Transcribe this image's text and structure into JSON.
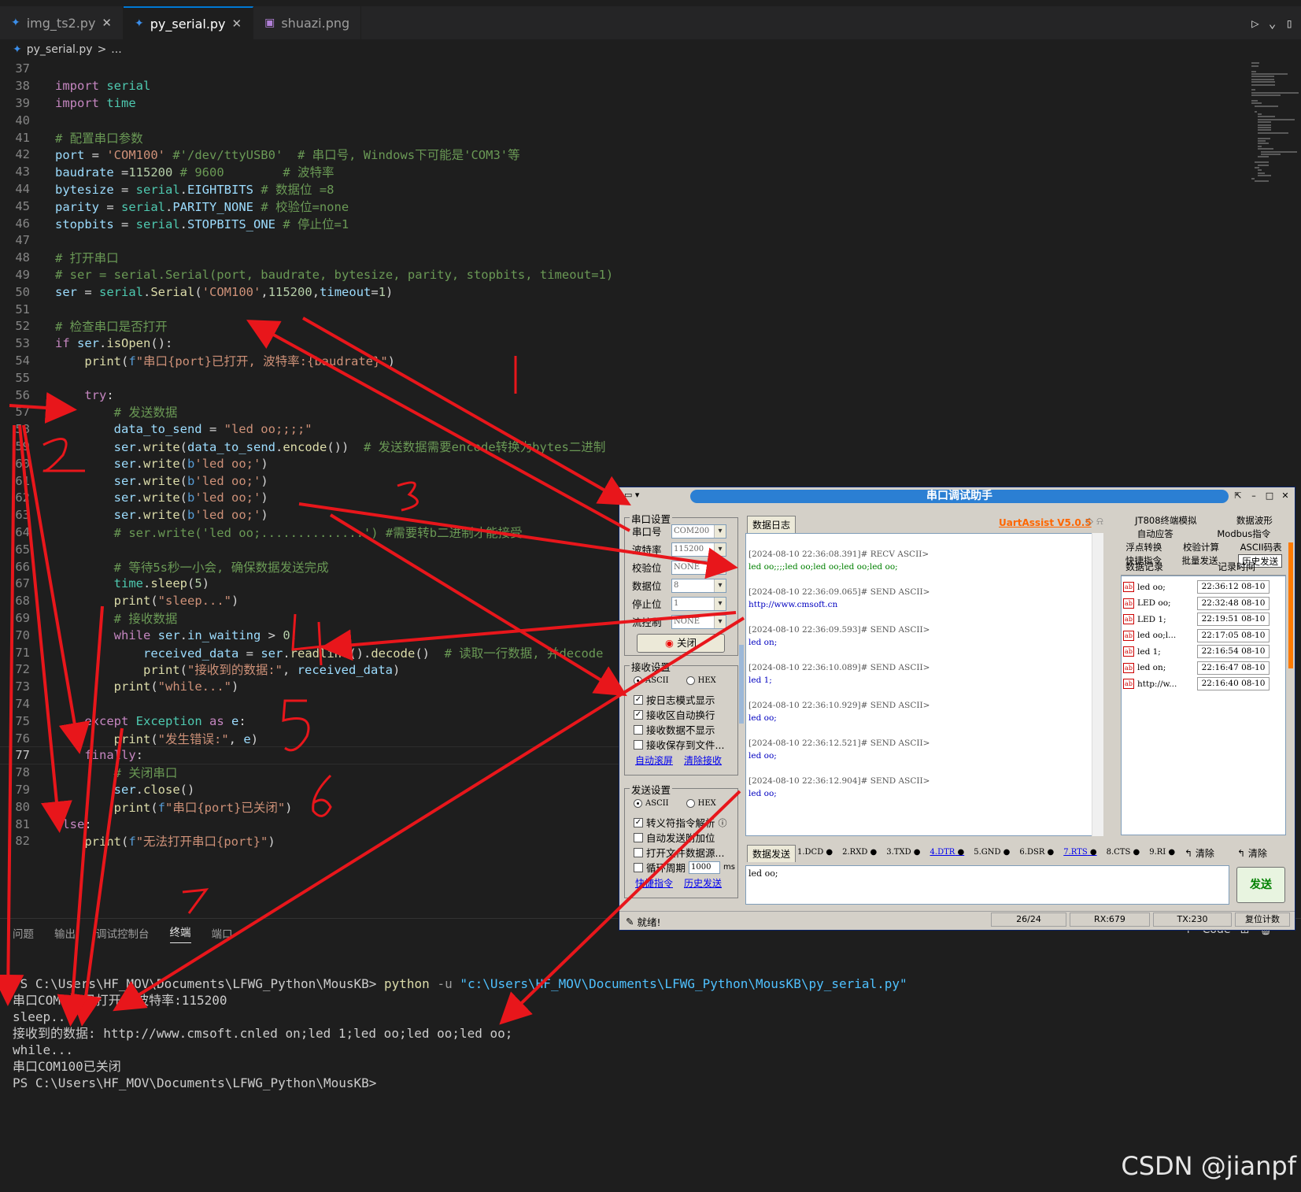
{
  "tabs": [
    {
      "label": "img_ts2.py",
      "icon": "python-file-icon"
    },
    {
      "label": "py_serial.py",
      "icon": "python-file-icon",
      "active": true
    },
    {
      "label": "shuazi.png",
      "icon": "image-file-icon"
    }
  ],
  "breadcrumb": {
    "file": "py_serial.py",
    "sep": ">",
    "more": "..."
  },
  "editor": {
    "current_line": "77",
    "lines": [
      {
        "n": "37",
        "t": ""
      },
      {
        "n": "38",
        "t": "import serial"
      },
      {
        "n": "39",
        "t": "import time"
      },
      {
        "n": "40",
        "t": ""
      },
      {
        "n": "41",
        "t": "# 配置串口参数"
      },
      {
        "n": "42",
        "t": "port = 'COM100' #'/dev/ttyUSB0'  # 串口号, Windows下可能是'COM3'等"
      },
      {
        "n": "43",
        "t": "baudrate =115200 # 9600        # 波特率"
      },
      {
        "n": "44",
        "t": "bytesize = serial.EIGHTBITS # 数据位 =8"
      },
      {
        "n": "45",
        "t": "parity = serial.PARITY_NONE # 校验位=none"
      },
      {
        "n": "46",
        "t": "stopbits = serial.STOPBITS_ONE # 停止位=1"
      },
      {
        "n": "47",
        "t": ""
      },
      {
        "n": "48",
        "t": "# 打开串口"
      },
      {
        "n": "49",
        "t": "# ser = serial.Serial(port, baudrate, bytesize, parity, stopbits, timeout=1)"
      },
      {
        "n": "50",
        "t": "ser = serial.Serial('COM100',115200,timeout=1)"
      },
      {
        "n": "51",
        "t": ""
      },
      {
        "n": "52",
        "t": "# 检查串口是否打开"
      },
      {
        "n": "53",
        "t": "if ser.isOpen():"
      },
      {
        "n": "54",
        "t": "    print(f\"串口{port}已打开, 波特率:{baudrate}\")"
      },
      {
        "n": "55",
        "t": ""
      },
      {
        "n": "56",
        "t": "    try:"
      },
      {
        "n": "57",
        "t": "        # 发送数据"
      },
      {
        "n": "58",
        "t": "        data_to_send = \"led oo;;;;\""
      },
      {
        "n": "59",
        "t": "        ser.write(data_to_send.encode())  # 发送数据需要encode转换为bytes二进制"
      },
      {
        "n": "60",
        "t": "        ser.write(b'led oo;')"
      },
      {
        "n": "61",
        "t": "        ser.write(b'led oo;')"
      },
      {
        "n": "62",
        "t": "        ser.write(b'led oo;')"
      },
      {
        "n": "63",
        "t": "        ser.write(b'led oo;')"
      },
      {
        "n": "64",
        "t": "        # ser.write('led oo;..............') #需要转b二进制才能接受"
      },
      {
        "n": "65",
        "t": ""
      },
      {
        "n": "66",
        "t": "        # 等待5s秒一小会, 确保数据发送完成"
      },
      {
        "n": "67",
        "t": "        time.sleep(5)"
      },
      {
        "n": "68",
        "t": "        print(\"sleep...\")"
      },
      {
        "n": "69",
        "t": "        # 接收数据"
      },
      {
        "n": "70",
        "t": "        while ser.in_waiting > 0:"
      },
      {
        "n": "71",
        "t": "            received_data = ser.readline().decode()  # 读取一行数据, 并decode"
      },
      {
        "n": "72",
        "t": "            print(\"接收到的数据:\", received_data)"
      },
      {
        "n": "73",
        "t": "        print(\"while...\")"
      },
      {
        "n": "74",
        "t": ""
      },
      {
        "n": "75",
        "t": "    except Exception as e:"
      },
      {
        "n": "76",
        "t": "        print(\"发生错误:\", e)"
      },
      {
        "n": "77",
        "t": "    finally:"
      },
      {
        "n": "78",
        "t": "        # 关闭串口"
      },
      {
        "n": "79",
        "t": "        ser.close()"
      },
      {
        "n": "80",
        "t": "        print(f\"串口{port}已关闭\")"
      },
      {
        "n": "81",
        "t": "else:"
      },
      {
        "n": "82",
        "t": "    print(f\"无法打开串口{port}\")"
      }
    ]
  },
  "panel": {
    "tabs": [
      "问题",
      "输出",
      "调试控制台",
      "终端",
      "端口"
    ],
    "active_tab": "终端",
    "actions": [
      "+",
      "Code",
      "⊞",
      "🗑",
      "⋯"
    ],
    "terminal_lines": [
      "PS C:\\Users\\HF_MOV\\Documents\\LFWG_Python\\MousKB> python -u \"c:\\Users\\HF_MOV\\Documents\\LFWG_Python\\MousKB\\py_serial.py\"",
      "串口COM100已打开, 波特率:115200",
      "sleep...",
      "接收到的数据: http://www.cmsoft.cnled on;led 1;led oo;led oo;led oo;",
      "while...",
      "串口COM100已关闭",
      "PS C:\\Users\\HF_MOV\\Documents\\LFWG_Python\\MousKB>"
    ],
    "cmd": {
      "prompt": "PS C:\\Users\\HF_MOV\\Documents\\LFWG_Python\\MousKB> ",
      "exe": "python",
      "flag": " -u ",
      "path": "\"c:\\Users\\HF_MOV\\Documents\\LFWG_Python\\MousKB\\py_serial.py\""
    }
  },
  "watermark": "CSDN @jianpf",
  "uart": {
    "title": "串口调试助手",
    "brand": "UartAssist V5.0.5",
    "port_group": "串口设置",
    "port_label": "串口号",
    "port_value": "COM200",
    "baud_label": "波特率",
    "baud_value": "115200",
    "parity_label": "校验位",
    "parity_value": "NONE",
    "data_label": "数据位",
    "data_value": "8",
    "stop_label": "停止位",
    "stop_value": "1",
    "flow_label": "流控制",
    "flow_value": "NONE",
    "close_button": "关闭",
    "recv_group": "接收设置",
    "ascii": "ASCII",
    "hex": "HEX",
    "recv_opts": [
      "按日志模式显示",
      "接收区自动换行",
      "接收数据不显示",
      "接收保存到文件..."
    ],
    "recv_links": [
      "自动滚屏",
      "清除接收"
    ],
    "send_group": "发送设置",
    "send_opts": [
      "转义符指令解析",
      "自动发送附加位",
      "打开文件数据源...",
      "循环周期"
    ],
    "cycle_value": "1000",
    "cycle_unit": "ms",
    "send_links": [
      "快捷指令",
      "历史发送"
    ],
    "log_tab": "数据日志",
    "log_entries": [
      {
        "h": "[2024-08-10 22:36:08.391]# RECV ASCII>",
        "b": "led oo;;;;led oo;led oo;led oo;led oo;",
        "c": "green"
      },
      {
        "h": "[2024-08-10 22:36:09.065]# SEND ASCII>",
        "b": "http://www.cmsoft.cn",
        "c": "blue"
      },
      {
        "h": "[2024-08-10 22:36:09.593]# SEND ASCII>",
        "b": "led on;",
        "c": "blue"
      },
      {
        "h": "[2024-08-10 22:36:10.089]# SEND ASCII>",
        "b": "led 1;",
        "c": "blue"
      },
      {
        "h": "[2024-08-10 22:36:10.929]# SEND ASCII>",
        "b": "led oo;",
        "c": "blue"
      },
      {
        "h": "[2024-08-10 22:36:12.521]# SEND ASCII>",
        "b": "led oo;",
        "c": "blue"
      },
      {
        "h": "[2024-08-10 22:36:12.904]# SEND ASCII>",
        "b": "led oo;",
        "c": "blue"
      }
    ],
    "send_tab": "数据发送",
    "pins": [
      "1.DCD",
      "2.RXD",
      "3.TXD",
      "4.DTR",
      "5.GND",
      "6.DSR",
      "7.RTS",
      "8.CTS",
      "9.RI"
    ],
    "clear1": "清除",
    "clear2": "清除",
    "send_text": "led oo;",
    "send_button": "发送",
    "right_tabs_row1": [
      "JT808终端模拟",
      "数据波形"
    ],
    "right_tabs_row2": [
      "自动应答",
      "Modbus指令"
    ],
    "right_tabs_row3": [
      "浮点转换",
      "校验计算",
      "ASCII码表"
    ],
    "right_tabs_row4": [
      "快捷指令",
      "批量发送",
      "历史发送"
    ],
    "hist_headers": [
      "数据记录",
      "记录时间"
    ],
    "hist_rows": [
      {
        "d": "led oo;",
        "t": "22:36:12 08-10"
      },
      {
        "d": "LED oo;",
        "t": "22:32:48 08-10"
      },
      {
        "d": "LED 1;",
        "t": "22:19:51 08-10"
      },
      {
        "d": "led oo;l...",
        "t": "22:17:05 08-10"
      },
      {
        "d": "led 1;",
        "t": "22:16:54 08-10"
      },
      {
        "d": "led on;",
        "t": "22:16:47 08-10"
      },
      {
        "d": "http://w...",
        "t": "22:16:40 08-10"
      }
    ],
    "status": "就绪!",
    "counter": "26/24",
    "rx": "RX:679",
    "tx": "TX:230",
    "reset": "复位计数"
  },
  "annotations": [
    "2",
    "3",
    "4",
    "5",
    "6",
    "7"
  ]
}
